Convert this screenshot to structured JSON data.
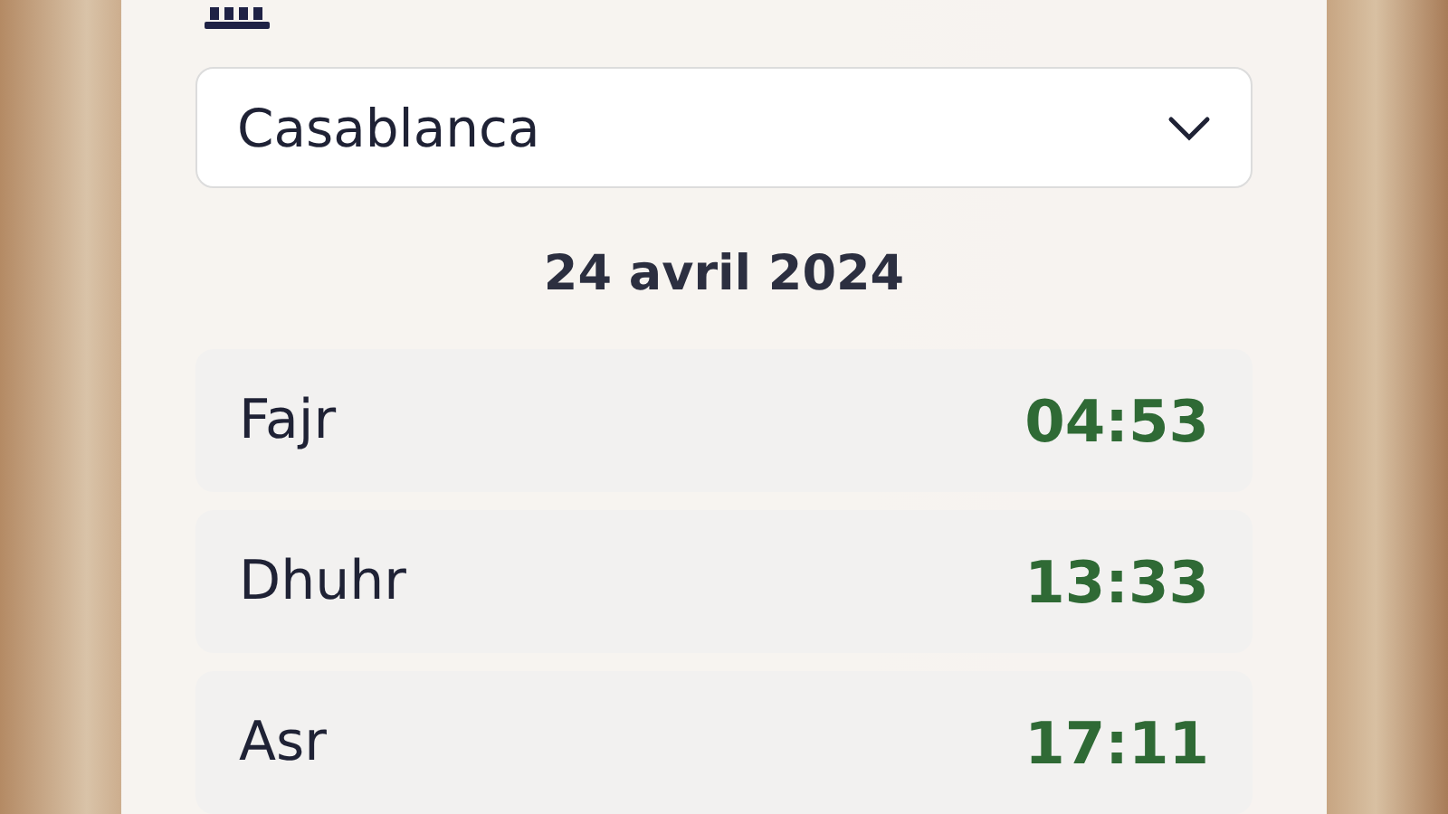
{
  "city_select": {
    "value": "Casablanca"
  },
  "date": "24 avril 2024",
  "prayers": [
    {
      "name": "Fajr",
      "time": "04:53"
    },
    {
      "name": "Dhuhr",
      "time": "13:33"
    },
    {
      "name": "Asr",
      "time": "17:11"
    }
  ]
}
